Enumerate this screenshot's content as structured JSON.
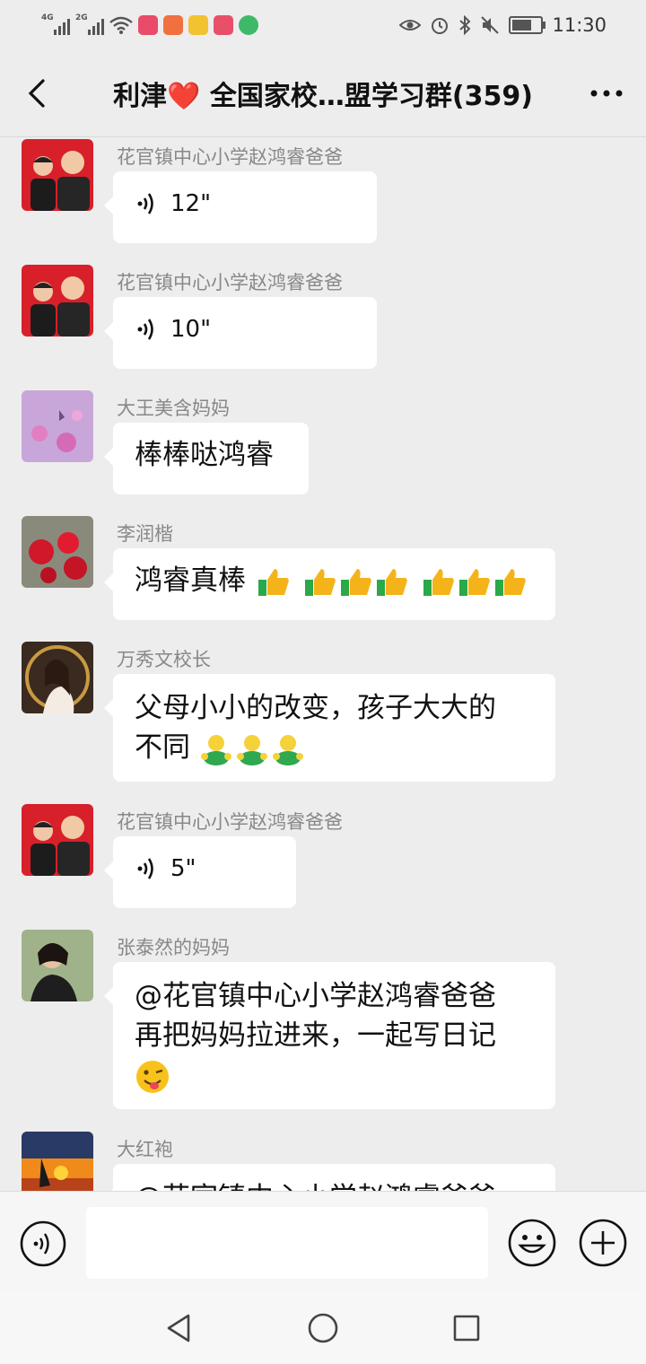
{
  "status_bar": {
    "signal_1": "4G",
    "signal_2": "2G",
    "time": "11:30",
    "battery_level": 0.6,
    "icons": [
      "signal-4g-icon",
      "signal-2g-icon",
      "wifi-icon",
      "app-notification-icon",
      "eye-icon",
      "alarm-icon",
      "bluetooth-icon",
      "mute-icon",
      "battery-icon"
    ]
  },
  "header": {
    "title": "利津❤️ 全国家校…盟学习群(359)",
    "back_icon": "chevron-left-icon",
    "more_icon": "more-dots-icon"
  },
  "messages": [
    {
      "sender": "花官镇中心小学赵鸿睿爸爸",
      "type": "voice",
      "duration": "12\"",
      "avatar": "father-son-avatar"
    },
    {
      "sender": "花官镇中心小学赵鸿睿爸爸",
      "type": "voice",
      "duration": "10\"",
      "avatar": "father-son-avatar"
    },
    {
      "sender": "大王美含妈妈",
      "type": "text",
      "text": "棒棒哒鸿睿",
      "avatar": "purple-flowers-avatar"
    },
    {
      "sender": "李润楷",
      "type": "text",
      "text": "鸿睿真棒",
      "emoji": [
        "thumbs-up",
        "thumbs-up",
        "thumbs-up",
        "thumbs-up",
        "thumbs-up",
        "thumbs-up",
        "thumbs-up"
      ],
      "avatar": "red-roses-avatar"
    },
    {
      "sender": "万秀文校长",
      "type": "text",
      "text_line1": "父母小小的改变，孩子大大的",
      "text_line2": "不同",
      "emoji": [
        "hug",
        "hug",
        "hug"
      ],
      "avatar": "woman-portrait-avatar"
    },
    {
      "sender": "花官镇中心小学赵鸿睿爸爸",
      "type": "voice",
      "duration": "5\"",
      "avatar": "father-son-avatar"
    },
    {
      "sender": "张泰然的妈妈",
      "type": "text",
      "text_line1": "@花官镇中心小学赵鸿睿爸爸",
      "text_line2": "再把妈妈拉进来，一起写日记",
      "emoji": [
        "wink-tongue"
      ],
      "avatar": "woman-photo-avatar"
    },
    {
      "sender": "大红袍",
      "type": "text",
      "text_partial": "@花官镇中心小学赵鸿睿爸爸",
      "avatar": "sunset-sailboat-avatar"
    }
  ],
  "input_bar": {
    "voice_icon": "voice-input-icon",
    "text_value": "",
    "emoji_icon": "emoji-smile-icon",
    "plus_icon": "plus-circle-icon"
  },
  "system_nav": {
    "back_icon": "nav-back-triangle-icon",
    "home_icon": "nav-home-circle-icon",
    "recents_icon": "nav-recents-square-icon"
  },
  "colors": {
    "background": "#ededed",
    "bubble": "#ffffff",
    "sender_name": "#888888",
    "heart": "#e0202a"
  }
}
